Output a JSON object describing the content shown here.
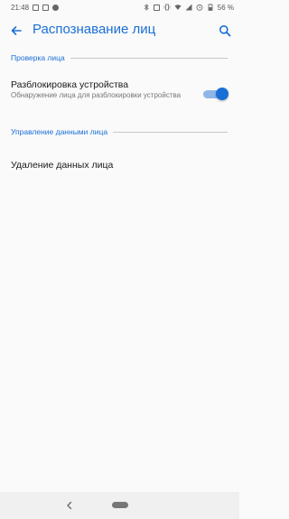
{
  "status_bar": {
    "time": "21:48",
    "battery_text": "56 %"
  },
  "app_bar": {
    "title": "Распознавание лиц"
  },
  "sections": [
    {
      "title": "Проверка лица"
    },
    {
      "title": "Управление данными лица"
    }
  ],
  "device_unlock": {
    "title": "Разблокировка устройства",
    "summary": "Обнаружение лица для разблокировки устройства",
    "enabled": true
  },
  "delete_face_data": {
    "title": "Удаление данных лица"
  },
  "colors": {
    "accent": "#1a6fd6",
    "toggle_track": "#8fb6e8",
    "background": "#fafafa"
  },
  "icons": {
    "back": "arrow-left-icon",
    "search": "search-icon",
    "nav_back": "chevron-left-icon",
    "nav_home": "home-pill-icon"
  }
}
